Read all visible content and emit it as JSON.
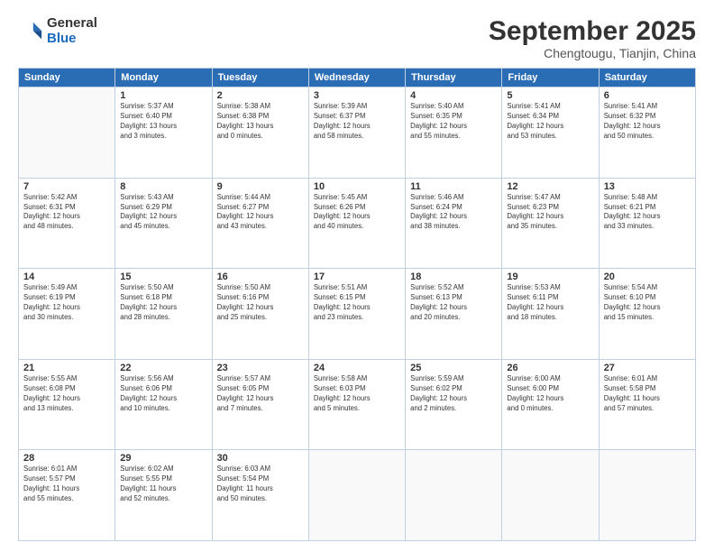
{
  "logo": {
    "general": "General",
    "blue": "Blue"
  },
  "header": {
    "month": "September 2025",
    "location": "Chengtougu, Tianjin, China"
  },
  "weekdays": [
    "Sunday",
    "Monday",
    "Tuesday",
    "Wednesday",
    "Thursday",
    "Friday",
    "Saturday"
  ],
  "weeks": [
    [
      {
        "day": "",
        "info": ""
      },
      {
        "day": "1",
        "info": "Sunrise: 5:37 AM\nSunset: 6:40 PM\nDaylight: 13 hours\nand 3 minutes."
      },
      {
        "day": "2",
        "info": "Sunrise: 5:38 AM\nSunset: 6:38 PM\nDaylight: 13 hours\nand 0 minutes."
      },
      {
        "day": "3",
        "info": "Sunrise: 5:39 AM\nSunset: 6:37 PM\nDaylight: 12 hours\nand 58 minutes."
      },
      {
        "day": "4",
        "info": "Sunrise: 5:40 AM\nSunset: 6:35 PM\nDaylight: 12 hours\nand 55 minutes."
      },
      {
        "day": "5",
        "info": "Sunrise: 5:41 AM\nSunset: 6:34 PM\nDaylight: 12 hours\nand 53 minutes."
      },
      {
        "day": "6",
        "info": "Sunrise: 5:41 AM\nSunset: 6:32 PM\nDaylight: 12 hours\nand 50 minutes."
      }
    ],
    [
      {
        "day": "7",
        "info": "Sunrise: 5:42 AM\nSunset: 6:31 PM\nDaylight: 12 hours\nand 48 minutes."
      },
      {
        "day": "8",
        "info": "Sunrise: 5:43 AM\nSunset: 6:29 PM\nDaylight: 12 hours\nand 45 minutes."
      },
      {
        "day": "9",
        "info": "Sunrise: 5:44 AM\nSunset: 6:27 PM\nDaylight: 12 hours\nand 43 minutes."
      },
      {
        "day": "10",
        "info": "Sunrise: 5:45 AM\nSunset: 6:26 PM\nDaylight: 12 hours\nand 40 minutes."
      },
      {
        "day": "11",
        "info": "Sunrise: 5:46 AM\nSunset: 6:24 PM\nDaylight: 12 hours\nand 38 minutes."
      },
      {
        "day": "12",
        "info": "Sunrise: 5:47 AM\nSunset: 6:23 PM\nDaylight: 12 hours\nand 35 minutes."
      },
      {
        "day": "13",
        "info": "Sunrise: 5:48 AM\nSunset: 6:21 PM\nDaylight: 12 hours\nand 33 minutes."
      }
    ],
    [
      {
        "day": "14",
        "info": "Sunrise: 5:49 AM\nSunset: 6:19 PM\nDaylight: 12 hours\nand 30 minutes."
      },
      {
        "day": "15",
        "info": "Sunrise: 5:50 AM\nSunset: 6:18 PM\nDaylight: 12 hours\nand 28 minutes."
      },
      {
        "day": "16",
        "info": "Sunrise: 5:50 AM\nSunset: 6:16 PM\nDaylight: 12 hours\nand 25 minutes."
      },
      {
        "day": "17",
        "info": "Sunrise: 5:51 AM\nSunset: 6:15 PM\nDaylight: 12 hours\nand 23 minutes."
      },
      {
        "day": "18",
        "info": "Sunrise: 5:52 AM\nSunset: 6:13 PM\nDaylight: 12 hours\nand 20 minutes."
      },
      {
        "day": "19",
        "info": "Sunrise: 5:53 AM\nSunset: 6:11 PM\nDaylight: 12 hours\nand 18 minutes."
      },
      {
        "day": "20",
        "info": "Sunrise: 5:54 AM\nSunset: 6:10 PM\nDaylight: 12 hours\nand 15 minutes."
      }
    ],
    [
      {
        "day": "21",
        "info": "Sunrise: 5:55 AM\nSunset: 6:08 PM\nDaylight: 12 hours\nand 13 minutes."
      },
      {
        "day": "22",
        "info": "Sunrise: 5:56 AM\nSunset: 6:06 PM\nDaylight: 12 hours\nand 10 minutes."
      },
      {
        "day": "23",
        "info": "Sunrise: 5:57 AM\nSunset: 6:05 PM\nDaylight: 12 hours\nand 7 minutes."
      },
      {
        "day": "24",
        "info": "Sunrise: 5:58 AM\nSunset: 6:03 PM\nDaylight: 12 hours\nand 5 minutes."
      },
      {
        "day": "25",
        "info": "Sunrise: 5:59 AM\nSunset: 6:02 PM\nDaylight: 12 hours\nand 2 minutes."
      },
      {
        "day": "26",
        "info": "Sunrise: 6:00 AM\nSunset: 6:00 PM\nDaylight: 12 hours\nand 0 minutes."
      },
      {
        "day": "27",
        "info": "Sunrise: 6:01 AM\nSunset: 5:58 PM\nDaylight: 11 hours\nand 57 minutes."
      }
    ],
    [
      {
        "day": "28",
        "info": "Sunrise: 6:01 AM\nSunset: 5:57 PM\nDaylight: 11 hours\nand 55 minutes."
      },
      {
        "day": "29",
        "info": "Sunrise: 6:02 AM\nSunset: 5:55 PM\nDaylight: 11 hours\nand 52 minutes."
      },
      {
        "day": "30",
        "info": "Sunrise: 6:03 AM\nSunset: 5:54 PM\nDaylight: 11 hours\nand 50 minutes."
      },
      {
        "day": "",
        "info": ""
      },
      {
        "day": "",
        "info": ""
      },
      {
        "day": "",
        "info": ""
      },
      {
        "day": "",
        "info": ""
      }
    ]
  ]
}
